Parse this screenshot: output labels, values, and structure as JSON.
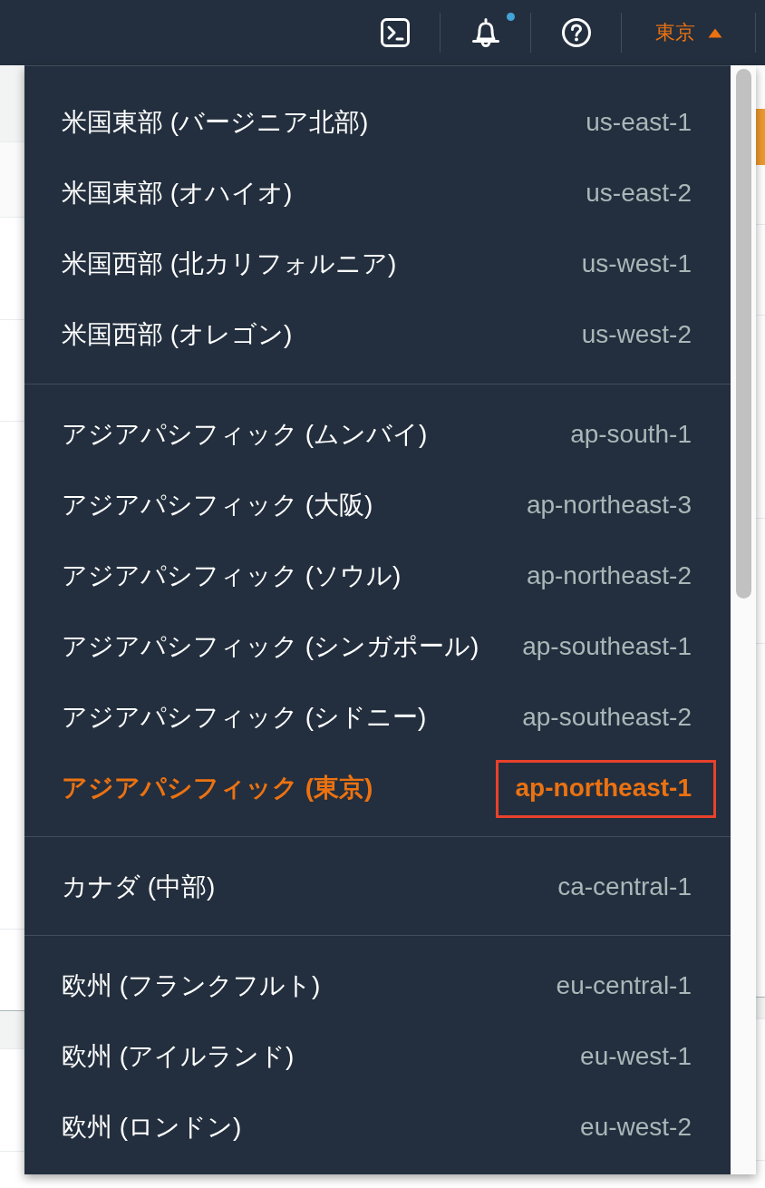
{
  "top_bar": {
    "notification_dot": true,
    "region": {
      "label": "東京",
      "expanded": true
    }
  },
  "region_menu": {
    "groups": [
      {
        "regions": [
          {
            "name": "米国東部 (バージニア北部)",
            "code": "us-east-1",
            "selected": false,
            "highlighted": false
          },
          {
            "name": "米国東部 (オハイオ)",
            "code": "us-east-2",
            "selected": false,
            "highlighted": false
          },
          {
            "name": "米国西部 (北カリフォルニア)",
            "code": "us-west-1",
            "selected": false,
            "highlighted": false
          },
          {
            "name": "米国西部 (オレゴン)",
            "code": "us-west-2",
            "selected": false,
            "highlighted": false
          }
        ]
      },
      {
        "regions": [
          {
            "name": "アジアパシフィック (ムンバイ)",
            "code": "ap-south-1",
            "selected": false,
            "highlighted": false
          },
          {
            "name": "アジアパシフィック (大阪)",
            "code": "ap-northeast-3",
            "selected": false,
            "highlighted": false
          },
          {
            "name": "アジアパシフィック (ソウル)",
            "code": "ap-northeast-2",
            "selected": false,
            "highlighted": false
          },
          {
            "name": "アジアパシフィック (シンガポール)",
            "code": "ap-southeast-1",
            "selected": false,
            "highlighted": false
          },
          {
            "name": "アジアパシフィック (シドニー)",
            "code": "ap-southeast-2",
            "selected": false,
            "highlighted": false
          },
          {
            "name": "アジアパシフィック (東京)",
            "code": "ap-northeast-1",
            "selected": true,
            "highlighted": true
          }
        ]
      },
      {
        "regions": [
          {
            "name": "カナダ (中部)",
            "code": "ca-central-1",
            "selected": false,
            "highlighted": false
          }
        ]
      },
      {
        "regions": [
          {
            "name": "欧州 (フランクフルト)",
            "code": "eu-central-1",
            "selected": false,
            "highlighted": false
          },
          {
            "name": "欧州 (アイルランド)",
            "code": "eu-west-1",
            "selected": false,
            "highlighted": false
          },
          {
            "name": "欧州 (ロンドン)",
            "code": "eu-west-2",
            "selected": false,
            "highlighted": false
          }
        ]
      }
    ]
  }
}
